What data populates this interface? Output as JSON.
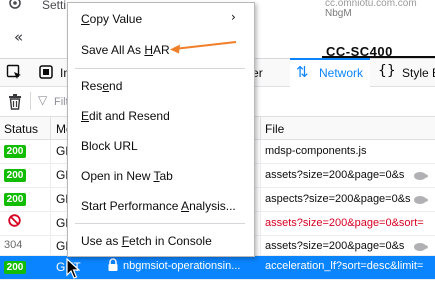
{
  "top": {
    "tab_text": "Setti",
    "right_text1": "cc.omniotu.com.com",
    "right_text2": "NbgM"
  },
  "page": {
    "collapse_glyph": "«",
    "tab_heading": "CC-SC400"
  },
  "toolbar": {
    "console_label": "In",
    "debugger_label": "ugger",
    "network_label": "Network",
    "network_glyph": "⇅",
    "style_glyph": "{}",
    "style_label": "Style E"
  },
  "filter": {
    "icon": "▽",
    "placeholder": "Filt"
  },
  "table": {
    "headers": {
      "status": "Status",
      "method": "Me",
      "file": "File"
    },
    "rows": [
      {
        "status": "200",
        "method": "GE",
        "file": "mdsp-components.js",
        "kind": "ok"
      },
      {
        "status": "200",
        "method": "GE",
        "file": "assets?size=200&page=0&s",
        "kind": "ok"
      },
      {
        "status": "200",
        "method": "GE",
        "file": "aspects?size=200&page=0&s",
        "kind": "ok"
      },
      {
        "status": "",
        "method": "GE",
        "file": "assets?size=200&page=0&sort=",
        "kind": "blocked"
      },
      {
        "status": "304",
        "method": "GE",
        "file": "assets?size=200&page=0&s",
        "kind": "cached"
      }
    ],
    "selected": {
      "status": "200",
      "method": "GET",
      "domain": "nbgmsiot-operationsin...",
      "file": "acceleration_lf?sort=desc&limit="
    }
  },
  "menu": {
    "copy_value": {
      "pre": "",
      "u": "C",
      "post": "opy Value"
    },
    "submenu_glyph": "›",
    "save_har": {
      "pre": "Save All As ",
      "u": "H",
      "post": "AR"
    },
    "resend": {
      "pre": "Res",
      "u": "e",
      "post": "nd"
    },
    "edit_resend": {
      "pre": "",
      "u": "E",
      "post": "dit and Resend"
    },
    "block_url": {
      "pre": "Block URL",
      "u": "",
      "post": ""
    },
    "open_new_tab": {
      "pre": "Open in New ",
      "u": "T",
      "post": "ab"
    },
    "start_perf": {
      "pre": "Start Performance ",
      "u": "A",
      "post": "nalysis..."
    },
    "fetch_console": {
      "pre": "Use as ",
      "u": "F",
      "post": "etch in Console"
    }
  },
  "colors": {
    "accent": "#0a84ff",
    "status_ok": "#12bc00",
    "error": "#d70022",
    "annotation": "#f07f2a"
  }
}
